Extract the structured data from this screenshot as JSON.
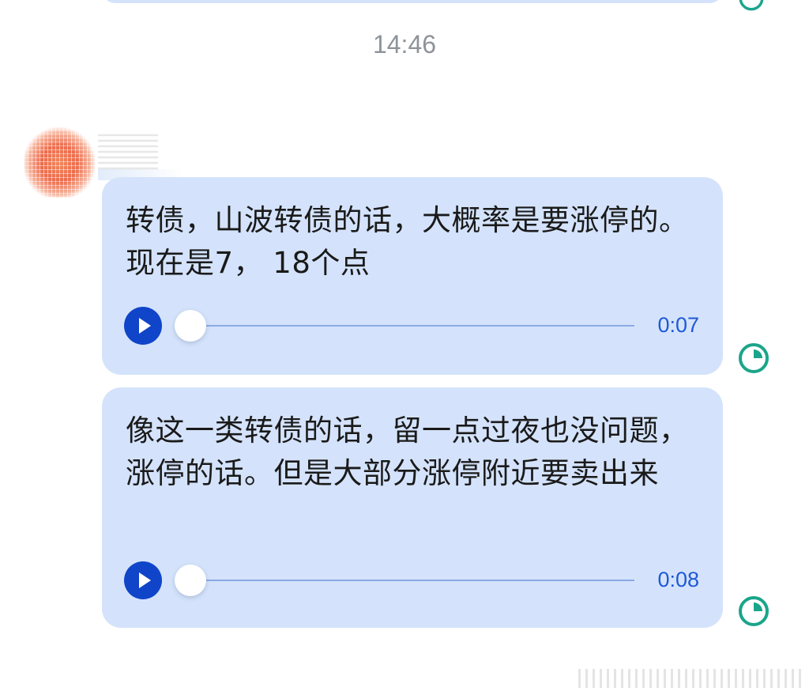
{
  "timestamp": "14:46",
  "colors": {
    "bubble": "#d4e3fb",
    "play_button": "#1045c9",
    "duration_text": "#1f59d6",
    "status_icon": "#1aa58a",
    "timestamp_text": "#8e939a"
  },
  "sender": {
    "avatar_icon": "blurred-avatar",
    "name_redacted": true
  },
  "messages": [
    {
      "text": "转债，山波转债的话，大概率是要涨停的。现在是7， 18个点",
      "duration": "0:07",
      "progress": 0,
      "play_icon": "play-icon",
      "status_icon": "clock-pending-icon"
    },
    {
      "text": "像这一类转债的话，留一点过夜也没问题，涨停的话。但是大部分涨停附近要卖出来",
      "duration": "0:08",
      "progress": 0,
      "play_icon": "play-icon",
      "status_icon": "clock-pending-icon"
    }
  ]
}
